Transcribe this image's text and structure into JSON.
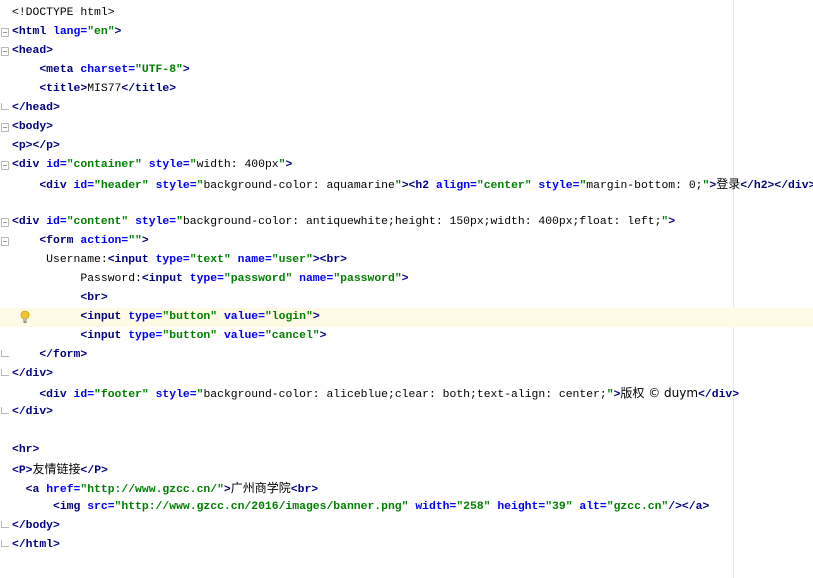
{
  "editor": {
    "lines": [
      {
        "segments": [
          {
            "t": "doc",
            "v": "<!DOCTYPE html>"
          }
        ]
      },
      {
        "segments": [
          {
            "t": "tag",
            "v": "<html "
          },
          {
            "t": "attr",
            "v": "lang="
          },
          {
            "t": "val",
            "v": "\"en\""
          },
          {
            "t": "tag",
            "v": ">"
          }
        ]
      },
      {
        "segments": [
          {
            "t": "tag",
            "v": "<head>"
          }
        ]
      },
      {
        "segments": [
          {
            "t": "txt",
            "v": "    "
          },
          {
            "t": "tag",
            "v": "<meta "
          },
          {
            "t": "attr",
            "v": "charset="
          },
          {
            "t": "val",
            "v": "\"UTF-8\""
          },
          {
            "t": "tag",
            "v": ">"
          }
        ]
      },
      {
        "segments": [
          {
            "t": "txt",
            "v": "    "
          },
          {
            "t": "tag",
            "v": "<title>"
          },
          {
            "t": "txt",
            "v": "MIS77"
          },
          {
            "t": "tag",
            "v": "</title>"
          }
        ]
      },
      {
        "segments": [
          {
            "t": "tag",
            "v": "</head>"
          }
        ]
      },
      {
        "segments": [
          {
            "t": "tag",
            "v": "<body>"
          }
        ]
      },
      {
        "segments": [
          {
            "t": "tag",
            "v": "<p></p>"
          }
        ]
      },
      {
        "segments": [
          {
            "t": "tag",
            "v": "<div "
          },
          {
            "t": "attr",
            "v": "id="
          },
          {
            "t": "val",
            "v": "\"container\" "
          },
          {
            "t": "attr",
            "v": "style="
          },
          {
            "t": "val",
            "v": "\""
          },
          {
            "t": "txt",
            "v": "width: 400px"
          },
          {
            "t": "val",
            "v": "\""
          },
          {
            "t": "tag",
            "v": ">"
          }
        ]
      },
      {
        "segments": [
          {
            "t": "txt",
            "v": "    "
          },
          {
            "t": "tag",
            "v": "<div "
          },
          {
            "t": "attr",
            "v": "id="
          },
          {
            "t": "val",
            "v": "\"header\" "
          },
          {
            "t": "attr",
            "v": "style="
          },
          {
            "t": "val",
            "v": "\""
          },
          {
            "t": "txt",
            "v": "background-color: aquamarine"
          },
          {
            "t": "val",
            "v": "\""
          },
          {
            "t": "tag",
            "v": ">"
          },
          {
            "t": "tag",
            "v": "<h2 "
          },
          {
            "t": "attr",
            "v": "align="
          },
          {
            "t": "val",
            "v": "\"center\" "
          },
          {
            "t": "attr",
            "v": "style="
          },
          {
            "t": "val",
            "v": "\""
          },
          {
            "t": "txt",
            "v": "margin-bottom: 0;"
          },
          {
            "t": "val",
            "v": "\""
          },
          {
            "t": "tag",
            "v": ">"
          },
          {
            "t": "cn",
            "v": "登录"
          },
          {
            "t": "tag",
            "v": "</h2></div>"
          }
        ]
      },
      {
        "segments": []
      },
      {
        "segments": [
          {
            "t": "tag",
            "v": "<div "
          },
          {
            "t": "attr",
            "v": "id="
          },
          {
            "t": "val",
            "v": "\"content\" "
          },
          {
            "t": "attr",
            "v": "style="
          },
          {
            "t": "val",
            "v": "\""
          },
          {
            "t": "txt",
            "v": "background-color: antiquewhite;height: 150px;width: 400px;float: left;"
          },
          {
            "t": "val",
            "v": "\""
          },
          {
            "t": "tag",
            "v": ">"
          }
        ]
      },
      {
        "segments": [
          {
            "t": "txt",
            "v": "    "
          },
          {
            "t": "tag",
            "v": "<form "
          },
          {
            "t": "attr",
            "v": "action="
          },
          {
            "t": "val",
            "v": "\"\""
          },
          {
            "t": "tag",
            "v": ">"
          }
        ]
      },
      {
        "segments": [
          {
            "t": "txt",
            "v": "     Username:"
          },
          {
            "t": "tag",
            "v": "<input "
          },
          {
            "t": "attr",
            "v": "type="
          },
          {
            "t": "val",
            "v": "\"text\" "
          },
          {
            "t": "attr",
            "v": "name="
          },
          {
            "t": "val",
            "v": "\"user\""
          },
          {
            "t": "tag",
            "v": "><br>"
          }
        ]
      },
      {
        "segments": [
          {
            "t": "txt",
            "v": "          Password:"
          },
          {
            "t": "tag",
            "v": "<input "
          },
          {
            "t": "attr",
            "v": "type="
          },
          {
            "t": "val",
            "v": "\"password\" "
          },
          {
            "t": "attr",
            "v": "name="
          },
          {
            "t": "val",
            "v": "\"password\""
          },
          {
            "t": "tag",
            "v": ">"
          }
        ]
      },
      {
        "segments": [
          {
            "t": "txt",
            "v": "          "
          },
          {
            "t": "tag",
            "v": "<br>"
          }
        ]
      },
      {
        "segments": [
          {
            "t": "txt",
            "v": "          "
          },
          {
            "t": "tag",
            "v": "<input "
          },
          {
            "t": "attr",
            "v": "type="
          },
          {
            "t": "val",
            "v": "\"button\" "
          },
          {
            "t": "attr",
            "v": "value="
          },
          {
            "t": "val",
            "v": "\"login\""
          },
          {
            "t": "tag",
            "v": ">"
          }
        ]
      },
      {
        "segments": [
          {
            "t": "txt",
            "v": "          "
          },
          {
            "t": "tag",
            "v": "<input "
          },
          {
            "t": "attr",
            "v": "type="
          },
          {
            "t": "val",
            "v": "\"button\" "
          },
          {
            "t": "attr",
            "v": "value="
          },
          {
            "t": "val",
            "v": "\"cancel\""
          },
          {
            "t": "tag",
            "v": ">"
          }
        ]
      },
      {
        "segments": [
          {
            "t": "txt",
            "v": "    "
          },
          {
            "t": "tag",
            "v": "</form>"
          }
        ]
      },
      {
        "segments": [
          {
            "t": "tag",
            "v": "</div>"
          }
        ]
      },
      {
        "segments": [
          {
            "t": "txt",
            "v": "    "
          },
          {
            "t": "tag",
            "v": "<div "
          },
          {
            "t": "attr",
            "v": "id="
          },
          {
            "t": "val",
            "v": "\"footer\" "
          },
          {
            "t": "attr",
            "v": "style="
          },
          {
            "t": "val",
            "v": "\""
          },
          {
            "t": "txt",
            "v": "background-color: aliceblue;clear: both;text-align: center;"
          },
          {
            "t": "val",
            "v": "\""
          },
          {
            "t": "tag",
            "v": ">"
          },
          {
            "t": "cn",
            "v": "版权 © duym"
          },
          {
            "t": "tag",
            "v": "</div>"
          }
        ]
      },
      {
        "segments": [
          {
            "t": "tag",
            "v": "</div>"
          }
        ]
      },
      {
        "segments": []
      },
      {
        "segments": [
          {
            "t": "tag",
            "v": "<hr>"
          }
        ]
      },
      {
        "segments": [
          {
            "t": "tag",
            "v": "<P>"
          },
          {
            "t": "cn",
            "v": "友情链接"
          },
          {
            "t": "tag",
            "v": "</P>"
          }
        ]
      },
      {
        "segments": [
          {
            "t": "txt",
            "v": "  "
          },
          {
            "t": "tag",
            "v": "<a "
          },
          {
            "t": "attr",
            "v": "href="
          },
          {
            "t": "val",
            "v": "\"http://www.gzcc.cn/\""
          },
          {
            "t": "tag",
            "v": ">"
          },
          {
            "t": "cn",
            "v": "广州商学院"
          },
          {
            "t": "tag",
            "v": "<br>"
          }
        ]
      },
      {
        "segments": [
          {
            "t": "txt",
            "v": "      "
          },
          {
            "t": "tag",
            "v": "<img "
          },
          {
            "t": "attr",
            "v": "src="
          },
          {
            "t": "val",
            "v": "\"http://www.gzcc.cn/2016/images/banner.png\" "
          },
          {
            "t": "attr",
            "v": "width="
          },
          {
            "t": "val",
            "v": "\"258\" "
          },
          {
            "t": "attr",
            "v": "height="
          },
          {
            "t": "val",
            "v": "\"39\" "
          },
          {
            "t": "attr",
            "v": "alt="
          },
          {
            "t": "val",
            "v": "\"gzcc.cn\""
          },
          {
            "t": "tag",
            "v": "/></a>"
          }
        ]
      },
      {
        "segments": [
          {
            "t": "tag",
            "v": "</body>"
          }
        ]
      },
      {
        "segments": [
          {
            "t": "tag",
            "v": "</html>"
          }
        ]
      }
    ],
    "current_line": 16,
    "lightbulb_icon": "lightbulb-icon",
    "colors": {
      "tag": "#000080",
      "attribute": "#0000ff",
      "value": "#008000",
      "current_line_bg": "#fffae3"
    }
  }
}
